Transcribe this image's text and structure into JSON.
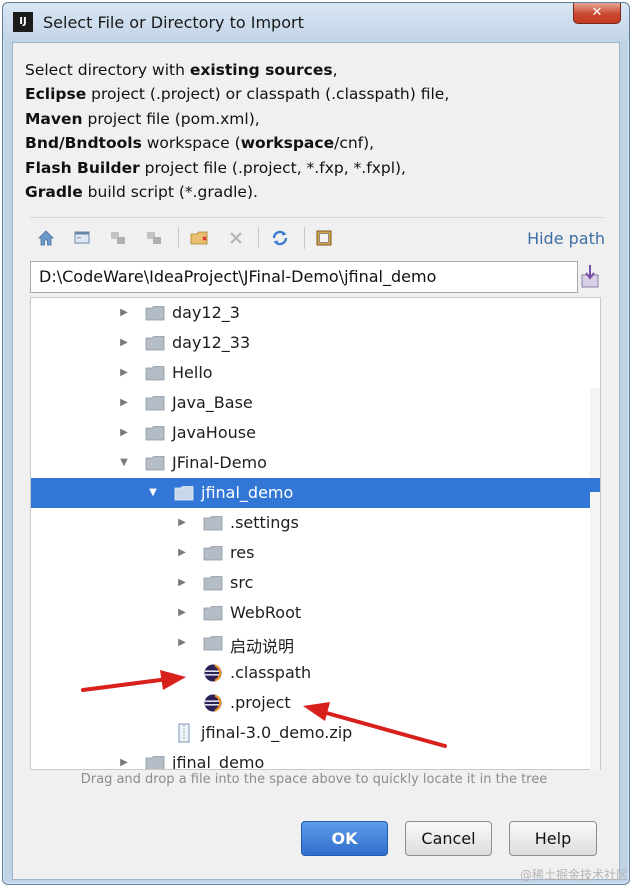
{
  "window": {
    "title": "Select File or Directory to Import",
    "app_icon_text": "IJ",
    "close_glyph": "✕"
  },
  "description": {
    "line1_plain": "Select directory with ",
    "line1_bold": "existing sources",
    "line1_end": ",",
    "line2_bold": "Eclipse",
    "line2_plain": " project (.project) or classpath (.classpath) file,",
    "line3_bold": "Maven",
    "line3_plain": " project file (pom.xml),",
    "line4_bold": "Bnd/Bndtools",
    "line4_plain": " workspace (",
    "line4_bold2": "workspace",
    "line4_end": "/cnf),",
    "line5_bold": "Flash Builder",
    "line5_plain": " project file (.project, *.fxp, *.fxpl),",
    "line6_bold": "Gradle",
    "line6_plain": " build script (*.gradle)."
  },
  "toolbar": {
    "icons": [
      "home-icon",
      "desktop-icon",
      "project-icon",
      "module-icon",
      "new-folder-icon",
      "delete-icon",
      "refresh-icon",
      "show-hidden-icon"
    ],
    "hide_path_label": "Hide path"
  },
  "path": {
    "value": "D:\\CodeWare\\IdeaProject\\JFinal-Demo\\jfinal_demo"
  },
  "tree": {
    "rows": [
      {
        "label": "day12_3",
        "type": "folder",
        "expanded": false
      },
      {
        "label": "day12_33",
        "type": "folder",
        "expanded": false
      },
      {
        "label": "Hello",
        "type": "folder",
        "expanded": false
      },
      {
        "label": "Java_Base",
        "type": "folder",
        "expanded": false
      },
      {
        "label": "JavaHouse",
        "type": "folder",
        "expanded": false
      },
      {
        "label": "JFinal-Demo",
        "type": "folder",
        "expanded": true
      },
      {
        "label": "jfinal_demo",
        "type": "folder",
        "expanded": true,
        "selected": true
      },
      {
        "label": ".settings",
        "type": "folder",
        "expanded": false
      },
      {
        "label": "res",
        "type": "folder",
        "expanded": false
      },
      {
        "label": "src",
        "type": "folder",
        "expanded": false
      },
      {
        "label": "WebRoot",
        "type": "folder",
        "expanded": false
      },
      {
        "label": "启动说明",
        "type": "folder",
        "expanded": false
      },
      {
        "label": ".classpath",
        "type": "eclipse-file"
      },
      {
        "label": ".project",
        "type": "eclipse-file"
      },
      {
        "label": "jfinal-3.0_demo.zip",
        "type": "zip-file"
      },
      {
        "label": "jfinal_demo",
        "type": "folder",
        "expanded": false
      }
    ]
  },
  "hint": "Drag and drop a file into the space above to quickly locate it in the tree",
  "buttons": {
    "ok": "OK",
    "cancel": "Cancel",
    "help": "Help"
  },
  "watermark": "@稀土掘金技术社区",
  "colors": {
    "selection": "#3277d6",
    "link": "#3c6fa6",
    "annotation_arrow": "#d8211c"
  }
}
